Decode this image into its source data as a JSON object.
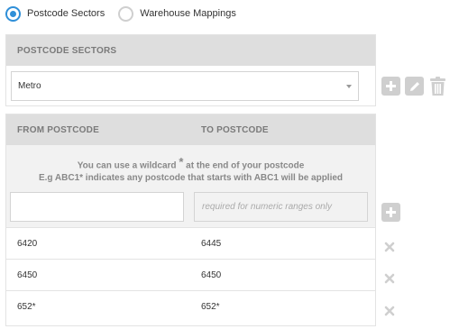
{
  "mode_selector": {
    "options": [
      {
        "label": "Postcode Sectors",
        "checked": true
      },
      {
        "label": "Warehouse Mappings",
        "checked": false
      }
    ]
  },
  "sectors": {
    "header": "POSTCODE SECTORS",
    "selected": "Metro"
  },
  "ranges": {
    "from_header": "FROM POSTCODE",
    "to_header": "TO POSTCODE",
    "hint_line1_a": "You can use a wildcard",
    "hint_star": "*",
    "hint_line1_b": "at the end of your postcode",
    "hint_line2": "E.g ABC1* indicates any postcode that starts with ABC1 will be applied",
    "from_value": "",
    "to_placeholder": "required for numeric ranges only",
    "rows": [
      {
        "from": "6420",
        "to": "6445"
      },
      {
        "from": "6450",
        "to": "6450"
      },
      {
        "from": "652*",
        "to": "652*"
      }
    ]
  },
  "colors": {
    "accent": "#2f8fd8",
    "header_bg": "#dedede",
    "icon_gray": "#cfcfcf"
  },
  "icons": [
    "plus-icon",
    "pencil-icon",
    "trash-icon",
    "close-icon"
  ]
}
